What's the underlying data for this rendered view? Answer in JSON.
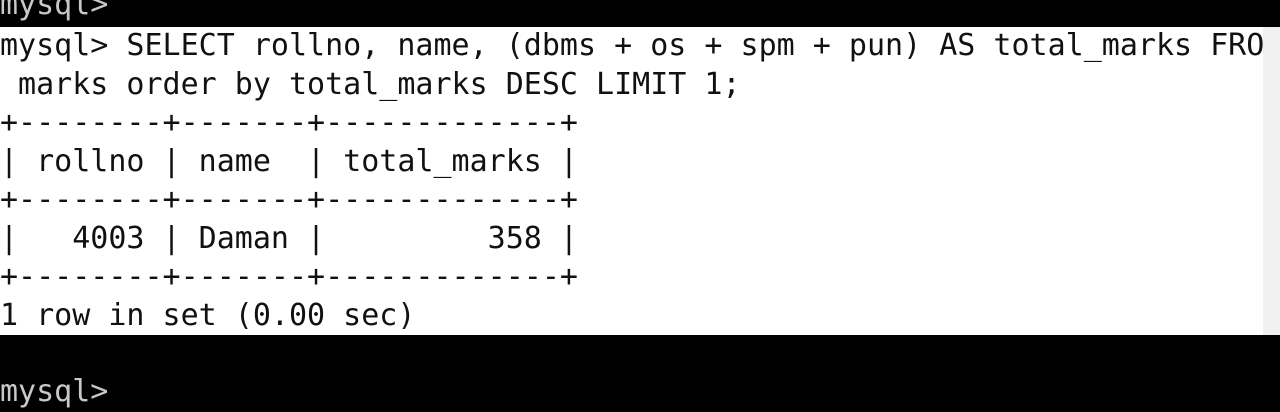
{
  "terminal": {
    "top_prompt": "mysql>",
    "query_line_1": "mysql> SELECT rollno, name, (dbms + os + spm + pun) AS total_marks FROM",
    "query_line_2": " marks order by total_marks DESC LIMIT 1;",
    "border_line": "+--------+-------+-------------+",
    "header_row": "| rollno | name  | total_marks |",
    "data_row": "|   4003 | Daman |         358 |",
    "result_status": "1 row in set (0.00 sec)",
    "bottom_prompt": "mysql>"
  },
  "result_table": {
    "columns": [
      "rollno",
      "name",
      "total_marks"
    ],
    "rows": [
      [
        "4003",
        "Daman",
        "358"
      ]
    ]
  },
  "colors": {
    "background": "#000000",
    "selection_background": "#ffffff",
    "text_on_dark": "#c8c8c8",
    "text_on_light": "#111111"
  }
}
